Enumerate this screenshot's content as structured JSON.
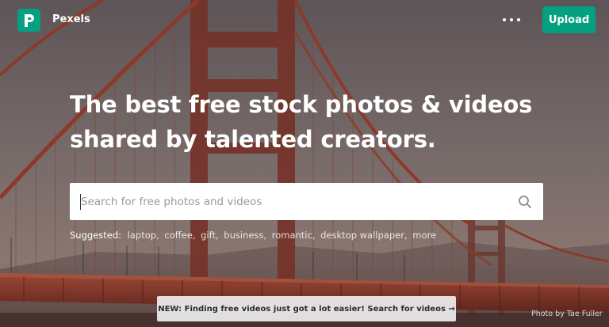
{
  "header": {
    "brand": "Pexels",
    "upload_label": "Upload",
    "more_icon": "more-dots-icon"
  },
  "hero": {
    "headline_line1": "The best free stock photos & videos",
    "headline_line2": "shared by talented creators."
  },
  "search": {
    "placeholder": "Search for free photos and videos",
    "value": "",
    "icon": "search-icon"
  },
  "suggested": {
    "label": "Suggested:",
    "tags": [
      "laptop",
      "coffee",
      "gift",
      "business",
      "romantic",
      "desktop wallpaper",
      "more"
    ]
  },
  "banner": {
    "text": "NEW: Finding free videos just got a lot easier! Search for videos →"
  },
  "photo_credit": "Photo by Tae Fuller",
  "colors": {
    "brand_green": "#05a081",
    "bridge_red": "#a8432f"
  }
}
